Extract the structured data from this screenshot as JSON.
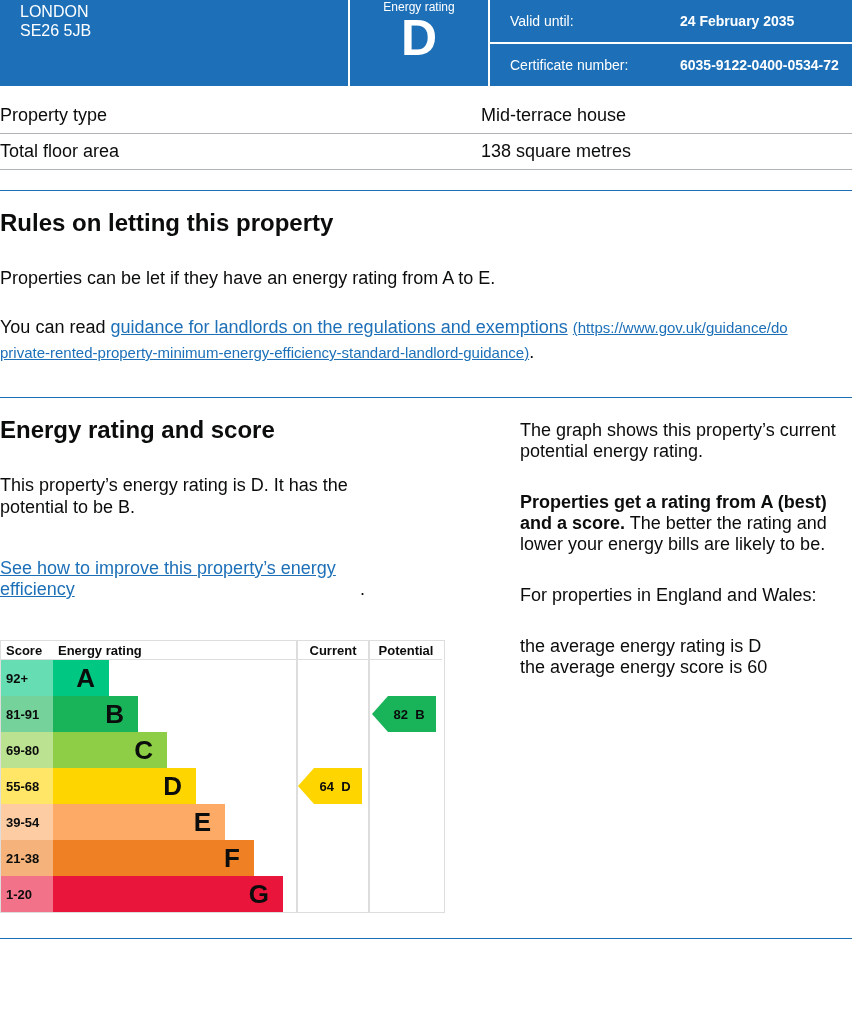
{
  "header": {
    "address_lines": [
      "LONDON",
      "SE26 5JB"
    ],
    "rating_label": "Energy rating",
    "rating": "D",
    "details": [
      {
        "label": "Valid until:",
        "value": "24 February 2035"
      },
      {
        "label": "Certificate number:",
        "value": "6035-9122-0400-0534-72"
      }
    ]
  },
  "summary": [
    {
      "label": "Property type",
      "value": "Mid-terrace house"
    },
    {
      "label": "Total floor area",
      "value": "138 square metres"
    }
  ],
  "letting": {
    "heading": "Rules on letting this property",
    "text": "Properties can be let if they have an energy rating from A to E.",
    "read_prefix": "You can read",
    "link": "guidance for landlords on the regulations and exemptions",
    "url_start": "(https://www.gov.uk/guidance/do",
    "url_end": "private-rented-property-minimum-energy-efficiency-standard-landlord-guidance)",
    "read_suffix": "."
  },
  "energy": {
    "heading": "Energy rating and score",
    "text": "This property’s energy rating is D. It has the potential to be B.",
    "link": "See how to improve this property’s energy efficiency",
    "link_suffix": ".",
    "graph": {
      "columns": [
        "Score",
        "Energy rating",
        "Current",
        "Potential"
      ],
      "bands": [
        {
          "score": "92+",
          "letter": "A",
          "color": "#00c781"
        },
        {
          "score": "81-91",
          "letter": "B",
          "color": "#19b459"
        },
        {
          "score": "69-80",
          "letter": "C",
          "color": "#8dce46"
        },
        {
          "score": "55-68",
          "letter": "D",
          "color": "#ffd500"
        },
        {
          "score": "39-54",
          "letter": "E",
          "color": "#fcaa65"
        },
        {
          "score": "21-38",
          "letter": "F",
          "color": "#ef8023"
        },
        {
          "score": "1-20",
          "letter": "G",
          "color": "#e9153b"
        }
      ],
      "current": {
        "score": "64",
        "rating": "D"
      },
      "potential": {
        "score": "82",
        "rating": "B"
      }
    },
    "side_paragraphs": [
      "The graph shows this property’s current\npotential energy rating.",
      "**Properties get a rating from A (best)\nand a score.** The better the rating and\nlower your energy bills are likely to be.",
      "For properties in England and Wales:",
      "the average energy rating is D\nthe average energy score is 60"
    ]
  }
}
